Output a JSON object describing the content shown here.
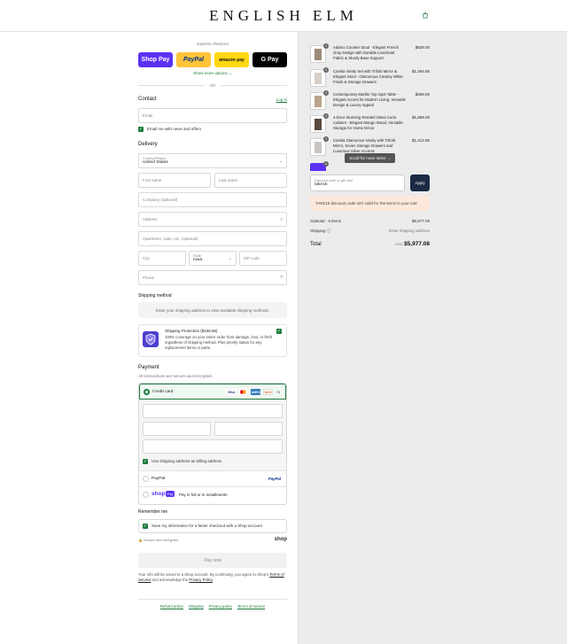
{
  "brand": "ENGLISH ELM",
  "express": {
    "title": "Express checkout",
    "shoppay": "Shop Pay",
    "paypal": "PayPal",
    "amazon": "amazon pay",
    "gpay": "G Pay",
    "more": "Show more options",
    "or": "OR"
  },
  "contact": {
    "title": "Contact",
    "login": "Log in",
    "email_placeholder": "Email",
    "email_news": "Email me with news and offers"
  },
  "delivery": {
    "title": "Delivery",
    "country_label": "Country/Region",
    "country_value": "United States",
    "first_name": "First name",
    "last_name": "Last name",
    "company": "Company (optional)",
    "address": "Address",
    "apartment": "Apartment, suite, etc. (optional)",
    "city": "City",
    "state_label": "State",
    "state_value": "Iowa",
    "zip": "ZIP code",
    "phone": "Phone"
  },
  "shipping": {
    "title": "Shipping method",
    "notice": "Enter your shipping address to view available shipping methods.",
    "protect_title": "Shipping Protection ($106.96)",
    "protect_desc": "100% coverage on your entire order from damage, loss, or theft regardless of shipping method. Plus priority status for any replacement items or parts."
  },
  "payment": {
    "title": "Payment",
    "subtitle": "All transactions are secure and encrypted.",
    "credit_card": "Credit card",
    "cards": [
      "VISA",
      "MC",
      "AMEX",
      "DISC"
    ],
    "more_cards": "+5",
    "billing_same": "Use shipping address as billing address",
    "paypal": "PayPal",
    "paypal_logo": "PayPal",
    "shoppay_logo": "shop",
    "shoppay_desc": "Pay in full or in installments"
  },
  "remember": {
    "title": "Remember me",
    "save_info": "Save my information for a faster checkout with a Shop account",
    "secure": "Secure and encrypted",
    "shop": "shop"
  },
  "paynow": "Pay now",
  "terms": {
    "pre": "Your info will be saved to a Shop account. By continuing, you agree to Shop's",
    "tos": "Terms of Service",
    "mid": "and acknowledge the",
    "privacy": "Privacy Policy",
    "end": "."
  },
  "footer": [
    "Refund policy",
    "Shipping",
    "Privacy policy",
    "Terms of service"
  ],
  "cart": {
    "items": [
      {
        "qty": "1",
        "name": "Adamo Counter Stool - Elegant French Gray Design with Durable LiveSmart Fabric & Sturdy Base Support",
        "price": "$829.00",
        "color": "#9a8a78"
      },
      {
        "qty": "1",
        "name": "Camila Vanity Set with Trifold Mirror & Elegant Stool - Glamorous Creamy White Finish & Storage Drawers",
        "price": "$1,494.55",
        "color": "#d6d0c8"
      },
      {
        "qty": "1",
        "name": "Contemporary Marble Top Spot Table - Elegant Accent for Modern Living, Versatile Design & Luxury Appeal",
        "price": "$269.00",
        "color": "#b8a48a"
      },
      {
        "qty": "1",
        "name": "4-Door Stunning Reeded Glass Curio Cabinet - Elegant Mango Wood, Versatile Storage for Home Décor",
        "price": "$1,869.00",
        "color": "#5a4a3e"
      },
      {
        "qty": "1",
        "name": "Camila Glamorous Vanity with Trifold Mirror, Seven Storage Drawers and Luxurious Silver Accents",
        "price": "$1,414.55",
        "color": "#c9c5c0"
      },
      {
        "qty": "1",
        "name": "",
        "price": "",
        "color": "#5a31f4"
      }
    ],
    "scroll_hint": "Scroll for more items",
    "discount_label": "Discount code or gift card",
    "discount_value": "take15",
    "apply": "Apply",
    "discount_error": "TAKE15 discount code isn't valid for the items in your cart",
    "subtotal_label": "Subtotal · 6 items",
    "subtotal_value": "$5,977.08",
    "shipping_label": "Shipping",
    "shipping_value": "Enter shipping address",
    "total_label": "Total",
    "currency": "USD",
    "total_value": "$5,977.08"
  },
  "colors": {
    "accent_green": "#1f7a3f",
    "shoppay": "#5a31f4",
    "paypal": "#ffc439",
    "apply_btn": "#1b2a45"
  }
}
